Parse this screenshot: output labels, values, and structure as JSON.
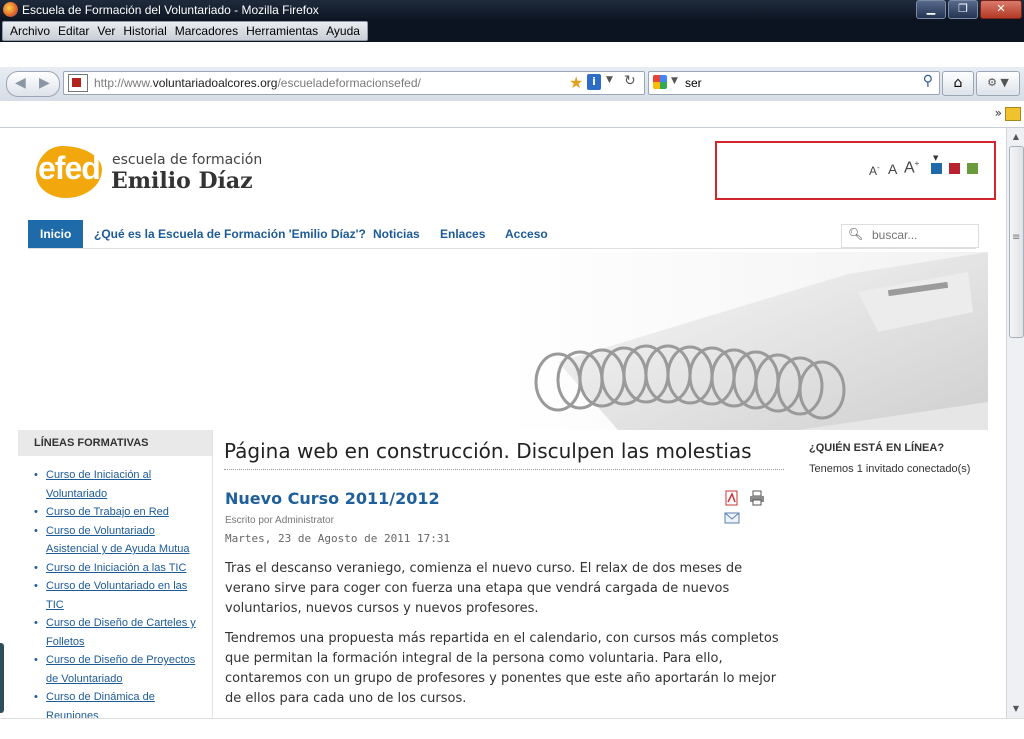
{
  "window": {
    "title": "Escuela de Formación del Voluntariado - Mozilla Firefox"
  },
  "menu": [
    "Archivo",
    "Editar",
    "Ver",
    "Historial",
    "Marcadores",
    "Herramientas",
    "Ayuda"
  ],
  "navbar": {
    "url_prefix": "http://www.",
    "url_domain": "voluntariadoalcores.org",
    "url_path": "/escueladeformacionsefed/",
    "search_value": "ser"
  },
  "site": {
    "logo_mark": "efed",
    "logo_line1": "escuela de formación",
    "logo_line2": "Emilio Díaz",
    "font_small": "A",
    "font_small_sup": "-",
    "font_normal": "A",
    "font_large": "A",
    "font_large_sup": "+",
    "themes": [
      {
        "name": "blue",
        "color": "#1f6aa8"
      },
      {
        "name": "red",
        "color": "#b8232f"
      },
      {
        "name": "green",
        "color": "#6b9a3a"
      }
    ]
  },
  "nav": {
    "items": [
      "Inicio",
      "¿Qué es la Escuela de Formación 'Emilio Díaz'?",
      "Noticias",
      "Enlaces",
      "Acceso"
    ],
    "search_placeholder": "buscar..."
  },
  "sidebar": {
    "heading": "LÍNEAS FORMATIVAS",
    "items": [
      "Curso de Iniciación al Voluntariado",
      "Curso de Trabajo en Red",
      "Curso de Voluntariado Asistencial y de Ayuda Mutua",
      "Curso de Iniciación a las TIC",
      "Curso de Voluntariado en las TIC",
      "Curso de Diseño de Carteles y Folletos",
      "Curso de Diseño de Proyectos de Voluntariado",
      "Curso de Dinámica de Reuniones"
    ]
  },
  "main": {
    "page_title": "Página web en construcción. Disculpen las molestias",
    "article_title": "Nuevo Curso 2011/2012",
    "author": "Escrito por Administrator",
    "date": "Martes, 23 de Agosto de 2011 17:31",
    "paragraph1": "Tras el descanso veraniego, comienza el nuevo curso. El relax de dos meses de verano sirve para coger con fuerza una etapa que vendrá cargada de nuevos voluntarios, nuevos cursos y nuevos profesores.",
    "paragraph2": "Tendremos una propuesta más repartida en el calendario, con cursos más completos que permitan la formación integral de la persona como voluntaria. Para ello, contaremos con un grupo de profesores y ponentes que este año aportarán lo mejor de ellos para cada uno de los cursos."
  },
  "right": {
    "heading": "¿QUIÉN ESTÁ EN LÍNEA?",
    "text": "Tenemos 1 invitado conectado(s)"
  }
}
